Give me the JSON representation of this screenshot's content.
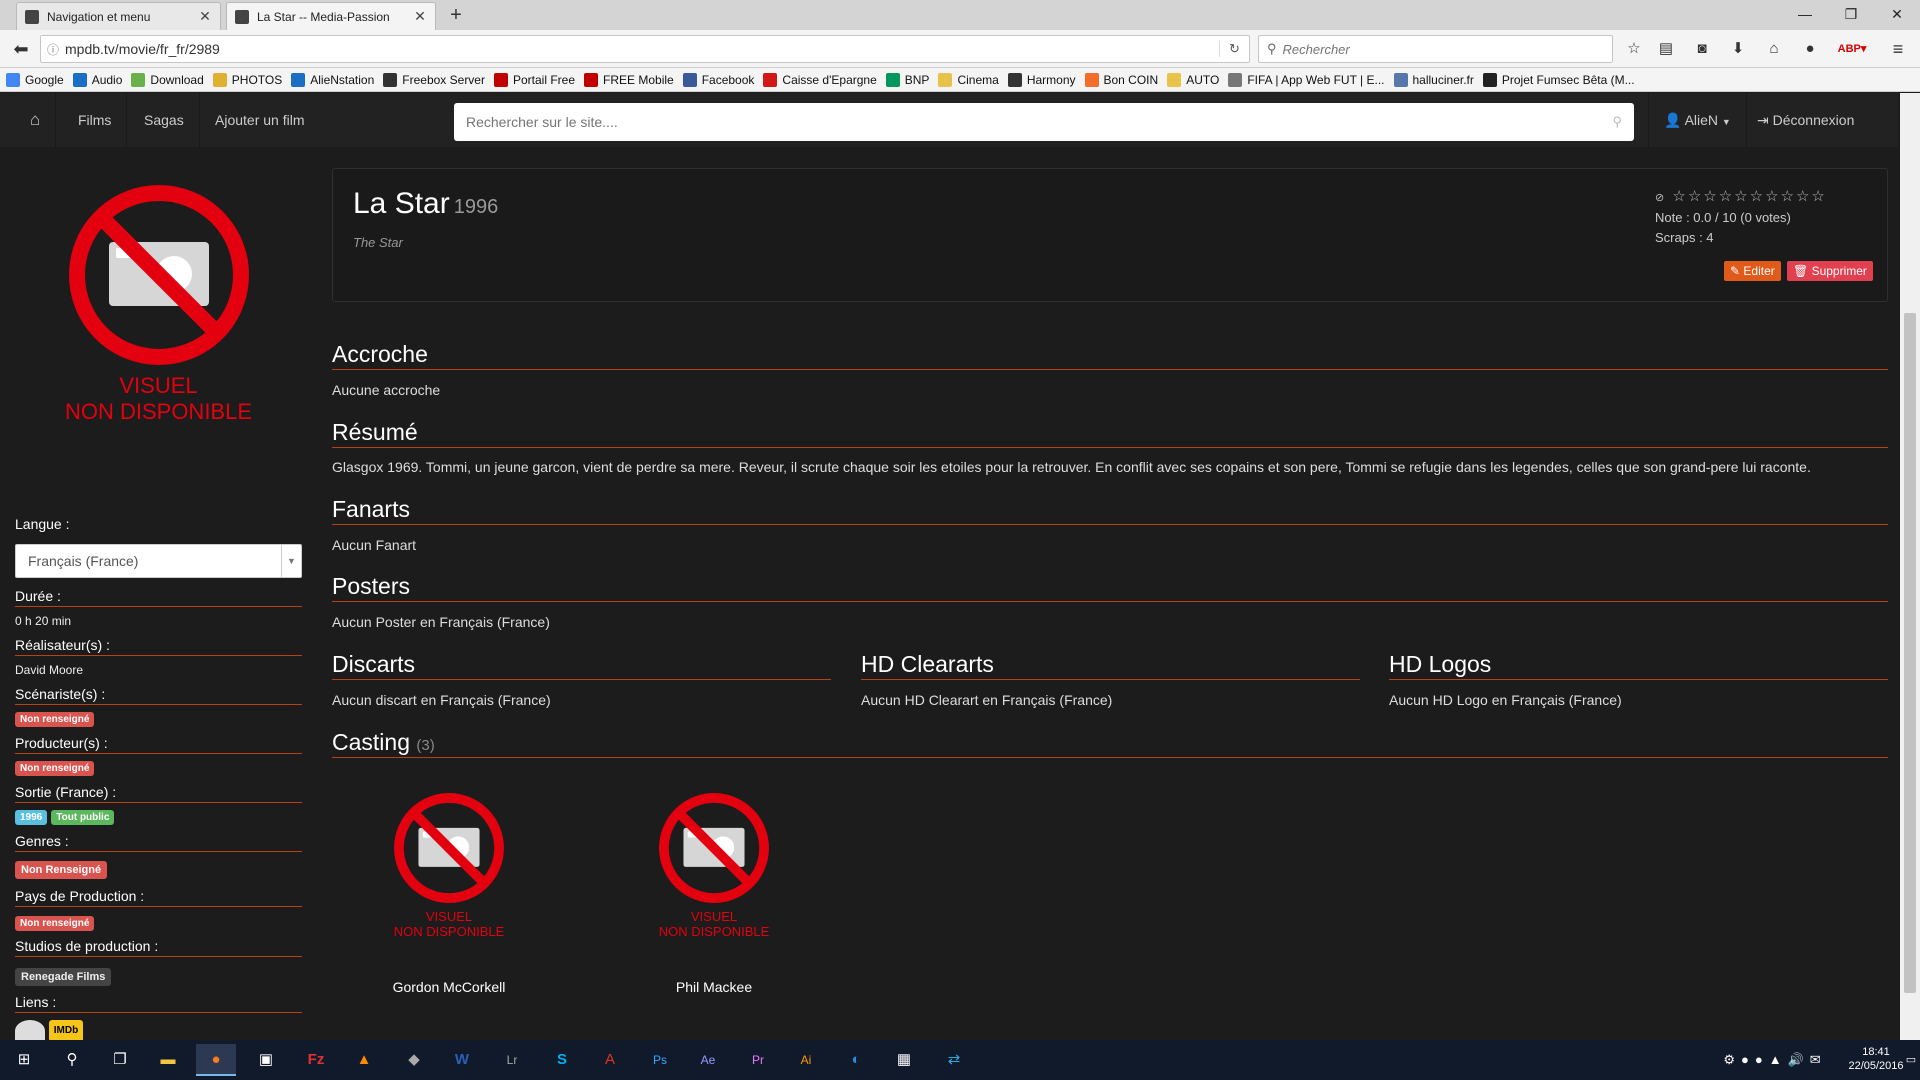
{
  "browser": {
    "tabs": [
      {
        "title": "Navigation et menu",
        "close": "✕"
      },
      {
        "title": "La Star -- Media-Passion",
        "close": "✕"
      }
    ],
    "newtab": "+",
    "window_controls": {
      "minimize": "—",
      "restore": "❐",
      "close": "✕"
    },
    "url": "mpdb.tv/movie/fr_fr/2989",
    "search_placeholder": "Rechercher",
    "bookmarks": [
      {
        "label": "Google",
        "color": "#4285f4"
      },
      {
        "label": "Audio",
        "color": "#1a6fc4"
      },
      {
        "label": "Download",
        "color": "#6ab04c"
      },
      {
        "label": "PHOTOS",
        "color": "#e0b030"
      },
      {
        "label": "AlieNstation",
        "color": "#1a6fc4"
      },
      {
        "label": "Freebox Server",
        "color": "#333333"
      },
      {
        "label": "Portail Free",
        "color": "#c00000"
      },
      {
        "label": "FREE Mobile",
        "color": "#c00000"
      },
      {
        "label": "Facebook",
        "color": "#3b5998"
      },
      {
        "label": "Caisse d'Epargne",
        "color": "#d01818"
      },
      {
        "label": "BNP",
        "color": "#00965e"
      },
      {
        "label": "Cinema",
        "color": "#e8c34a"
      },
      {
        "label": "Harmony",
        "color": "#333333"
      },
      {
        "label": "Bon COIN",
        "color": "#f56b2a"
      },
      {
        "label": "AUTO",
        "color": "#e8c34a"
      },
      {
        "label": "FIFA | App Web FUT | E...",
        "color": "#777777"
      },
      {
        "label": "halluciner.fr",
        "color": "#5577aa"
      },
      {
        "label": "Projet Fumsec Bêta (M...",
        "color": "#222222"
      }
    ]
  },
  "site": {
    "nav": {
      "home": "⌂",
      "films": "Films",
      "sagas": "Sagas",
      "add": "Ajouter un film",
      "user": "AlieN",
      "logout": "Déconnexion"
    },
    "search_placeholder": "Rechercher sur le site....",
    "poster": {
      "line1": "VISUEL",
      "line2": "NON DISPONIBLE"
    },
    "sidebar": {
      "langue_label": "Langue :",
      "langue_value": "Français (France)",
      "duree_label": "Durée :",
      "duree_value": "0 h 20 min",
      "realisateur_label": "Réalisateur(s) :",
      "realisateur_value": "David Moore",
      "scenariste_label": "Scénariste(s) :",
      "scenariste_value": "Non renseigné",
      "producteur_label": "Producteur(s) :",
      "producteur_value": "Non renseigné",
      "sortie_label": "Sortie (France) :",
      "sortie_year": "1996",
      "sortie_public": "Tout public",
      "genres_label": "Genres :",
      "genres_value": "Non Renseigné",
      "pays_label": "Pays de Production :",
      "pays_value": "Non renseigné",
      "studios_label": "Studios de production :",
      "studios_value": "Renegade Films",
      "liens_label": "Liens :",
      "liens_imdb": "IMDb"
    },
    "movie": {
      "title": "La Star",
      "year": "1996",
      "original_title": "The Star",
      "note": "Note : 0.0 / 10 (0 votes)",
      "scraps": "Scraps : 4",
      "edit": "Editer",
      "delete": "Supprimer"
    },
    "sections": {
      "accroche_title": "Accroche",
      "accroche_text": "Aucune accroche",
      "resume_title": "Résumé",
      "resume_text": "Glasgox 1969. Tommi, un jeune garcon, vient de perdre sa mere. Reveur, il scrute chaque soir les etoiles pour la retrouver. En conflit avec ses copains et son pere, Tommi se refugie dans les legendes, celles que son grand-pere lui raconte.",
      "fanarts_title": "Fanarts",
      "fanarts_text": "Aucun Fanart",
      "posters_title": "Posters",
      "posters_text": "Aucun Poster en Français (France)",
      "discarts_title": "Discarts",
      "discarts_text": "Aucun discart en Français (France)",
      "clearart_title": "HD Cleararts",
      "clearart_text": "Aucun HD Clearart en Français (France)",
      "logos_title": "HD Logos",
      "logos_text": "Aucun HD Logo en Français (France)",
      "casting_title": "Casting",
      "casting_count": "(3)"
    },
    "cast": [
      {
        "name": "Gordon McCorkell",
        "line1": "VISUEL",
        "line2": "NON DISPONIBLE"
      },
      {
        "name": "Phil Mackee",
        "line1": "VISUEL",
        "line2": "NON DISPONIBLE"
      }
    ]
  },
  "taskbar": {
    "time": "18:41",
    "date": "22/05/2016"
  },
  "colors": {
    "accent": "#b5421a",
    "no_visual_red": "#e3000f",
    "edit_orange": "#e05a1a"
  }
}
